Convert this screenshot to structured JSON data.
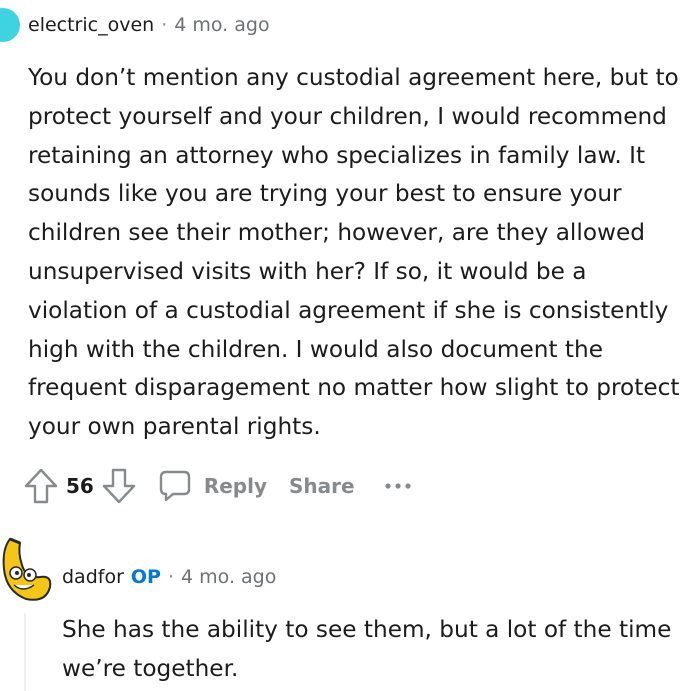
{
  "comment1": {
    "username": "electric_oven",
    "separator": "·",
    "time": "4 mo. ago",
    "body": "You don’t mention any custodial agreement here, but to protect yourself and your children, I would recommend retaining an attorney who specializes in family law. It sounds like you are trying your best to ensure your children see their mother; however, are they allowed unsupervised visits with her? If so, it would be a violation of a custodial agreement if she is consistently high with the children. I would also document the frequent disparagement no matter how slight to protect your own parental rights.",
    "votes": "56",
    "reply_label": "Reply",
    "share_label": "Share",
    "more_label": "···"
  },
  "comment2": {
    "username": "dadfor",
    "op_badge": "OP",
    "separator": "·",
    "time": "4 mo. ago",
    "body": "She has the ability to see them, but a lot of the time we’re together."
  },
  "colors": {
    "text": "#1c1c1c",
    "muted": "#878a8c",
    "op": "#0079d3",
    "avatar1": "#3fd2e0",
    "avatar2": "#f5c518"
  },
  "icons": {
    "upvote": "upvote-arrow-icon",
    "downvote": "downvote-arrow-icon",
    "reply": "speech-bubble-icon",
    "more": "ellipsis-icon"
  }
}
